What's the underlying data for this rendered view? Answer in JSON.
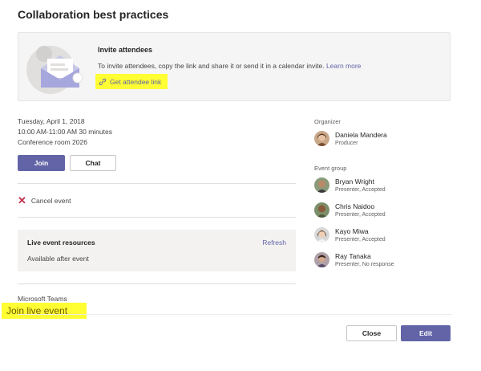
{
  "dialog": {
    "title": "Collaboration best practices"
  },
  "invite": {
    "title": "Invite attendees",
    "description": "To invite attendees, copy the link and share it or send it in a calendar invite.",
    "learn_more": "Learn more",
    "link_label": "Get attendee link",
    "highlight_color": "#ffff33"
  },
  "event": {
    "date": "Tuesday, April 1, 2018",
    "time": "10:00 AM-11:00 AM  30 minutes",
    "location": "Conference room 2026"
  },
  "actions": {
    "join": "Join",
    "chat": "Chat",
    "cancel": "Cancel event"
  },
  "resources": {
    "title": "Live event resources",
    "refresh": "Refresh",
    "status": "Available after event"
  },
  "teams": {
    "app_label": "Microsoft Teams",
    "join_live": "Join live event"
  },
  "organizer": {
    "label": "Organizer",
    "person": {
      "name": "Daniela Mandera",
      "role": "Producer"
    }
  },
  "event_group": {
    "label": "Event group",
    "members": [
      {
        "name": "Bryan Wright",
        "role": "Presenter, Accepted"
      },
      {
        "name": "Chris Naidoo",
        "role": "Presenter, Accepted"
      },
      {
        "name": "Kayo Miwa",
        "role": "Presenter, Accepted"
      },
      {
        "name": "Ray Tanaka",
        "role": "Presenter, No response"
      }
    ]
  },
  "footer": {
    "close": "Close",
    "edit": "Edit"
  },
  "colors": {
    "accent": "#6264a7",
    "danger": "#c4314b",
    "highlight": "#ffff33"
  }
}
